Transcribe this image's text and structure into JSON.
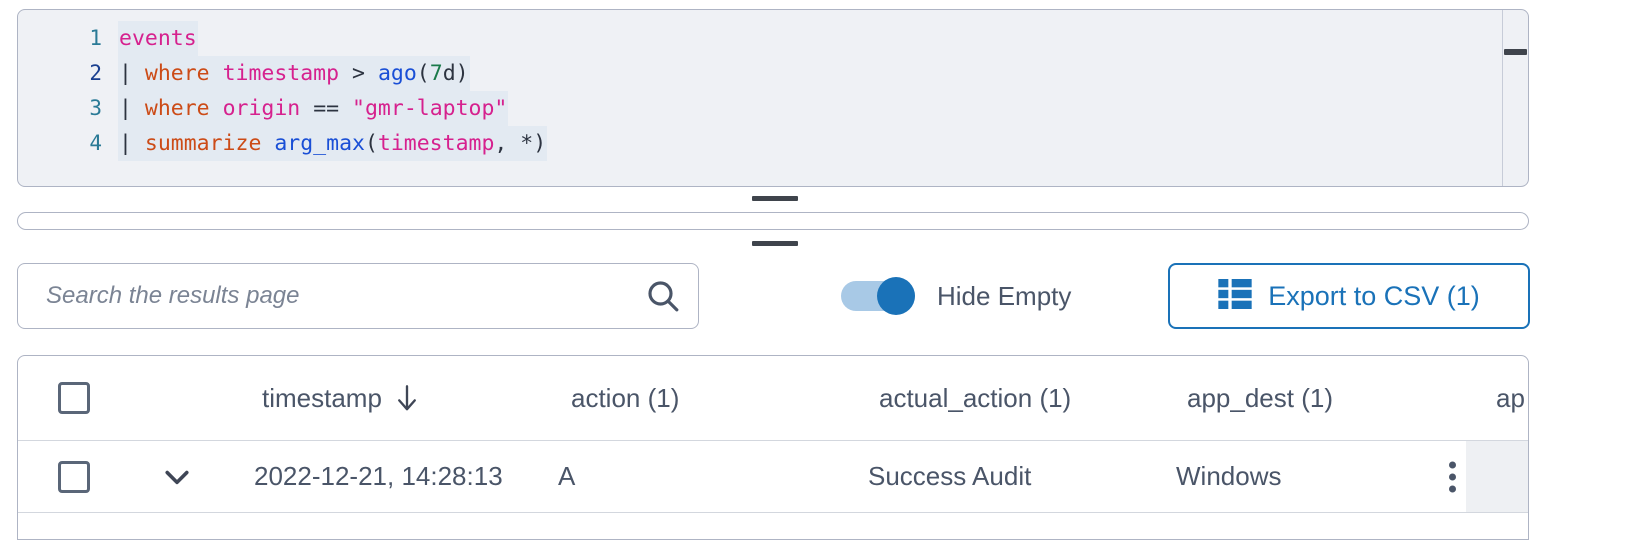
{
  "editor": {
    "lines": [
      {
        "number": "1",
        "active": false,
        "tokens": [
          {
            "text": "events",
            "type": "table"
          }
        ]
      },
      {
        "number": "2",
        "active": true,
        "tokens": [
          {
            "text": "| ",
            "type": "pipe"
          },
          {
            "text": "where",
            "type": "kw"
          },
          {
            "text": " ",
            "type": "punc"
          },
          {
            "text": "timestamp",
            "type": "col"
          },
          {
            "text": " ",
            "type": "punc"
          },
          {
            "text": ">",
            "type": "op"
          },
          {
            "text": " ",
            "type": "punc"
          },
          {
            "text": "ago",
            "type": "fn"
          },
          {
            "text": "(",
            "type": "punc"
          },
          {
            "text": "7",
            "type": "num"
          },
          {
            "text": "d",
            "type": "unit"
          },
          {
            "text": ")",
            "type": "punc"
          }
        ]
      },
      {
        "number": "3",
        "active": false,
        "tokens": [
          {
            "text": "| ",
            "type": "pipe"
          },
          {
            "text": "where",
            "type": "kw"
          },
          {
            "text": " ",
            "type": "punc"
          },
          {
            "text": "origin",
            "type": "col"
          },
          {
            "text": " ",
            "type": "punc"
          },
          {
            "text": "==",
            "type": "op"
          },
          {
            "text": " ",
            "type": "punc"
          },
          {
            "text": "\"gmr-laptop\"",
            "type": "str"
          }
        ]
      },
      {
        "number": "4",
        "active": false,
        "tokens": [
          {
            "text": "| ",
            "type": "pipe"
          },
          {
            "text": "summarize",
            "type": "kw"
          },
          {
            "text": " ",
            "type": "punc"
          },
          {
            "text": "arg_max",
            "type": "fn"
          },
          {
            "text": "(",
            "type": "punc"
          },
          {
            "text": "timestamp",
            "type": "col"
          },
          {
            "text": ", ",
            "type": "punc"
          },
          {
            "text": "*",
            "type": "op"
          },
          {
            "text": ")",
            "type": "punc"
          }
        ]
      }
    ],
    "query_text": "events | where timestamp > ago(7d) | where origin == \"gmr-laptop\" | summarize arg_max(timestamp, *)"
  },
  "toolbar": {
    "search_placeholder": "Search the results page",
    "search_value": "",
    "search_icon": "search-icon",
    "hide_empty_label": "Hide Empty",
    "hide_empty_on": true,
    "export_label": "Export to CSV (1)",
    "export_icon": "table-grid-icon",
    "accent_color": "#1a72b8"
  },
  "table": {
    "sort_column": "timestamp",
    "sort_direction": "desc",
    "sort_icon": "arrow-down-icon",
    "columns": [
      {
        "label": "timestamp",
        "sorted": true
      },
      {
        "label": "action (1)",
        "sorted": false
      },
      {
        "label": "actual_action (1)",
        "sorted": false
      },
      {
        "label": "app_dest (1)",
        "sorted": false
      },
      {
        "label": "ap",
        "sorted": false
      }
    ],
    "rows": [
      {
        "selected": false,
        "expanded": false,
        "timestamp": "2022-12-21, 14:28:13",
        "action": "A",
        "actual_action": "Success Audit",
        "app_dest": "Windows",
        "app_truncated": ""
      }
    ],
    "row_menu_icon": "kebab-menu-icon",
    "select_all_checked": false
  }
}
